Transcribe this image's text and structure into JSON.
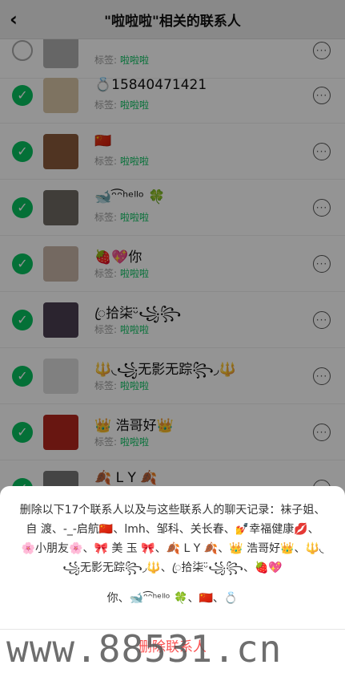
{
  "header": {
    "title": "\"啦啦啦\"相关的联系人",
    "back_icon": "‹"
  },
  "tag_label": "标签:",
  "contacts": [
    {
      "name": "",
      "tag": "啦啦啦",
      "checked": false,
      "avatar_bg": "#b0b0b0"
    },
    {
      "name": "💍15840471421",
      "tag": "啦啦啦",
      "checked": true,
      "avatar_bg": "#d9c7a8"
    },
    {
      "name": "🇨🇳",
      "tag": "啦啦啦",
      "checked": true,
      "avatar_bg": "#8a5a3c"
    },
    {
      "name": "🐋ᵔ͡ᵔʰᵉˡˡᵒ 🍀",
      "tag": "啦啦啦",
      "checked": true,
      "avatar_bg": "#6f6a62"
    },
    {
      "name": "🍓💖你",
      "tag": "啦啦啦",
      "checked": true,
      "avatar_bg": "#c9b5a7"
    },
    {
      "name": "ꦿ拾柒ᵕ̈꧁꧂",
      "tag": "啦啦啦",
      "checked": true,
      "avatar_bg": "#4a3f52"
    },
    {
      "name": "🔱◟꧁无影无踪꧂◞🔱",
      "tag": "啦啦啦",
      "checked": true,
      "avatar_bg": "#dcdcdc"
    },
    {
      "name": "👑 浩哥好👑",
      "tag": "啦啦啦",
      "checked": true,
      "avatar_bg": "#b3261e"
    },
    {
      "name": "🍂 L Y 🍂",
      "tag": "",
      "checked": true,
      "avatar_bg": "#777777"
    }
  ],
  "dialog": {
    "message_line1": "删除以下17个联系人以及与这些联系人的聊天记录：袜子姐、自 渡、-_-启航🇨🇳、lmh、邹科、关长春、💅幸福健康💋、🌸小朋友🌸、🎀 美 玉 🎀、🍂 L Y 🍂、👑 浩哥好👑、🔱◟꧁无影无踪꧂◞🔱、ꦿ拾柒ᵕ̈꧁꧂、🍓💖",
    "message_line2": "你、🐋ᵔ͡ᵔʰᵉˡˡᵒ 🍀、🇨🇳、💍",
    "delete_label": "删除联系人"
  },
  "watermark": "www.88531.cn",
  "colors": {
    "accent": "#07c160",
    "danger": "#fa5151"
  }
}
